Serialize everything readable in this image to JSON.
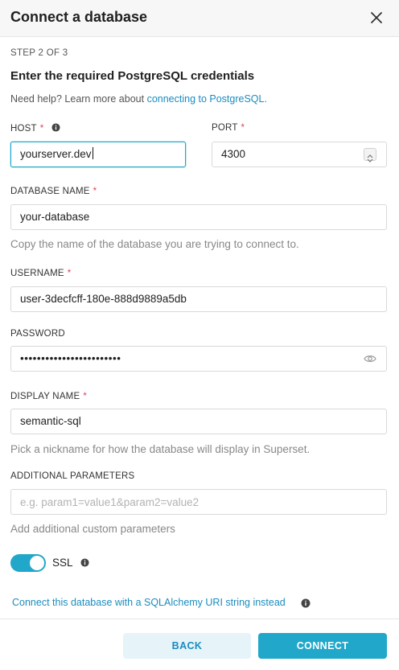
{
  "header": {
    "title": "Connect a database"
  },
  "step": "STEP 2 OF 3",
  "heading": "Enter the required PostgreSQL credentials",
  "help": {
    "prefix": "Need help? Learn more about ",
    "link": "connecting to PostgreSQL."
  },
  "fields": {
    "host": {
      "label": "HOST",
      "required": "*",
      "value": "yourserver.dev"
    },
    "port": {
      "label": "PORT",
      "required": "*",
      "value": "4300"
    },
    "database_name": {
      "label": "DATABASE NAME",
      "required": "*",
      "value": "your-database",
      "hint": "Copy the name of the database you are trying to connect to."
    },
    "username": {
      "label": "USERNAME",
      "required": "*",
      "value": "user-3decfcff-180e-888d9889a5db"
    },
    "password": {
      "label": "PASSWORD",
      "value": "••••••••••••••••••••••••"
    },
    "display_name": {
      "label": "DISPLAY NAME",
      "required": "*",
      "value": "semantic-sql",
      "hint": "Pick a nickname for how the database will display in Superset."
    },
    "additional_parameters": {
      "label": "ADDITIONAL PARAMETERS",
      "placeholder": "e.g. param1=value1&param2=value2",
      "hint": "Add additional custom parameters"
    }
  },
  "ssl": {
    "label": "SSL",
    "enabled": true
  },
  "sqlalchemy_link": "Connect this database with a SQLAlchemy URI string instead",
  "footer": {
    "back_label": "BACK",
    "connect_label": "CONNECT"
  },
  "colors": {
    "accent": "#20a7c9",
    "link": "#1b8cbf",
    "required": "#e04355"
  }
}
